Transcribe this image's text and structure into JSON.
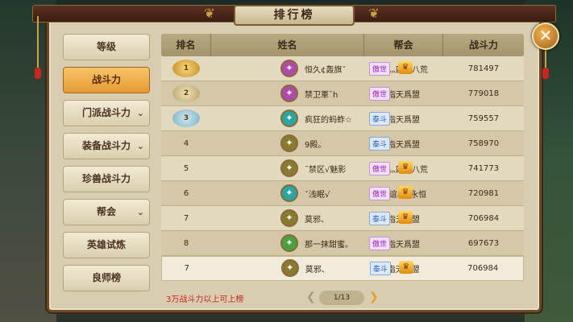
{
  "window": {
    "title": "排行榜"
  },
  "sidebar": {
    "items": [
      {
        "label": "等级",
        "active": false,
        "has_dropdown": false
      },
      {
        "label": "战斗力",
        "active": true,
        "has_dropdown": false
      },
      {
        "label": "门派战斗力",
        "active": false,
        "has_dropdown": true
      },
      {
        "label": "装备战斗力",
        "active": false,
        "has_dropdown": true
      },
      {
        "label": "珍兽战斗力",
        "active": false,
        "has_dropdown": false
      },
      {
        "label": "帮会",
        "active": false,
        "has_dropdown": true
      },
      {
        "label": "英雄试炼",
        "active": false,
        "has_dropdown": false
      },
      {
        "label": "良师榜",
        "active": false,
        "has_dropdown": false
      }
    ]
  },
  "table": {
    "headers": [
      "排名",
      "姓名",
      "帮会",
      "战斗力"
    ],
    "rows": [
      {
        "rank": "1",
        "medal": "gold",
        "avatar_color": "#b04aa8",
        "name": "恒久¢轰旗ˇ",
        "server": "傲世",
        "server_color": "purple",
        "vip": true,
        "guild": "彡灬四海八荒",
        "power": "781497"
      },
      {
        "rank": "2",
        "medal": "silver",
        "avatar_color": "#b04aa8",
        "name": "禁卫軍ˉh",
        "server": "傲世",
        "server_color": "purple",
        "vip": false,
        "guild": "指天爲盟",
        "power": "779018"
      },
      {
        "rank": "3",
        "medal": "bronze",
        "avatar_color": "#2aa5a0",
        "name": "疯狂的蚂蚱☆",
        "server": "泰斗",
        "server_color": "blue",
        "vip": false,
        "guild": "指天爲盟",
        "power": "759557"
      },
      {
        "rank": "4",
        "medal": "",
        "avatar_color": "#8a7a30",
        "name": "9殿。",
        "server": "泰斗",
        "server_color": "blue",
        "vip": false,
        "guild": "指天爲盟",
        "power": "758970"
      },
      {
        "rank": "5",
        "medal": "",
        "avatar_color": "#8a7a30",
        "name": "ˉ禁区√魅影",
        "server": "傲世",
        "server_color": "purple",
        "vip": true,
        "guild": "彡灬四海八荒",
        "power": "741773"
      },
      {
        "rank": "6",
        "medal": "",
        "avatar_color": "#2aa5a0",
        "name": "ˇ浅眠√",
        "server": "傲世",
        "server_color": "purple",
        "vip": true,
        "guild": "情谊are永恒",
        "power": "720981"
      },
      {
        "rank": "7",
        "medal": "",
        "avatar_color": "#8a7a30",
        "name": "莫邪、",
        "server": "泰斗",
        "server_color": "blue",
        "vip": true,
        "guild": "指天爲盟",
        "power": "706984"
      },
      {
        "rank": "8",
        "medal": "",
        "avatar_color": "#4aa040",
        "name": "那一抹甜蜜。",
        "server": "傲世",
        "server_color": "purple",
        "vip": false,
        "guild": "指天爲盟",
        "power": "697673"
      },
      {
        "rank": "7",
        "medal": "",
        "avatar_color": "#8a7a30",
        "name": "莫邪、",
        "server": "泰斗",
        "server_color": "blue",
        "vip": true,
        "guild": "指天爲盟",
        "power": "706984"
      }
    ]
  },
  "footer": {
    "note": "3万战斗力以上可上榜"
  },
  "pager": {
    "text": "1/13"
  },
  "icons": {
    "close": "close-icon",
    "prev": "chevron-left-icon",
    "next": "chevron-right-icon",
    "dropdown": "chevron-down-icon"
  }
}
